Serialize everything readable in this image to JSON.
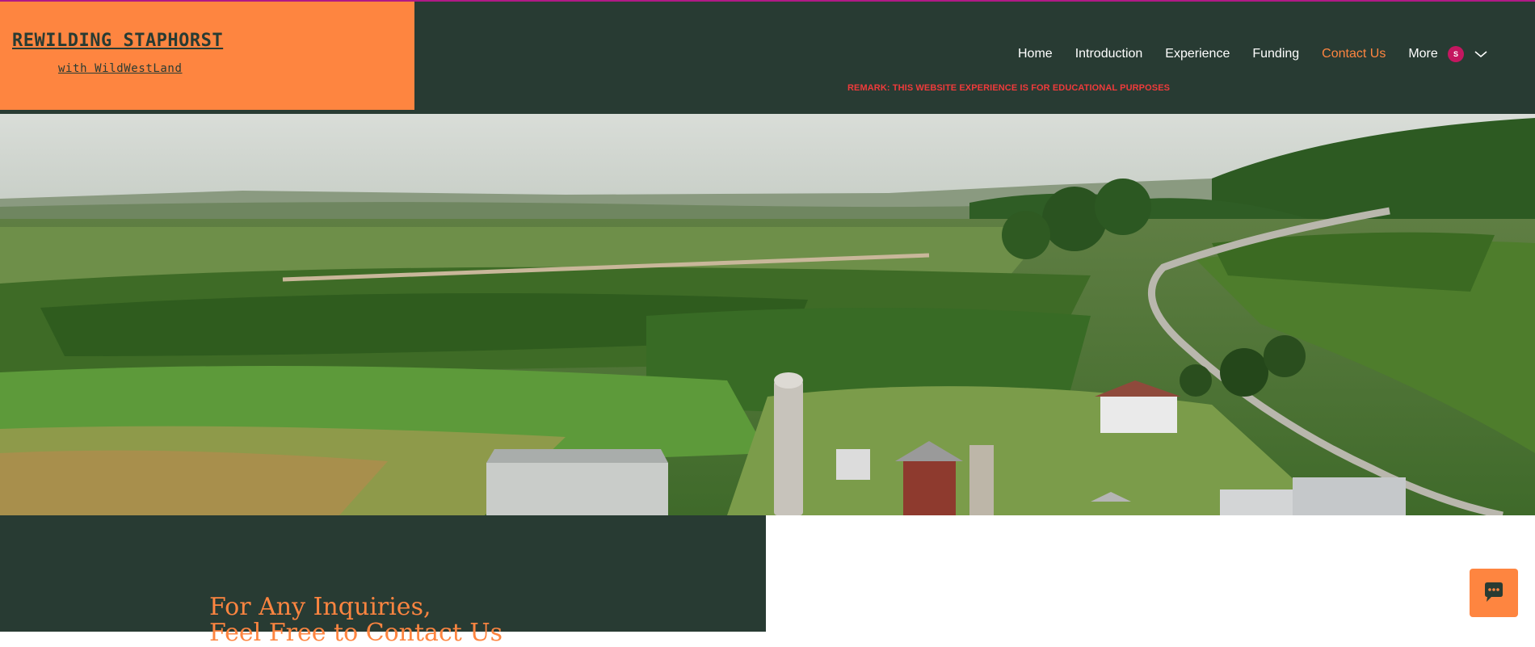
{
  "logo": {
    "title": "REWILDING STAPHORST",
    "subtitle": "with WildWestLand"
  },
  "nav": {
    "items": [
      {
        "label": "Home"
      },
      {
        "label": "Introduction"
      },
      {
        "label": "Experience"
      },
      {
        "label": "Funding"
      },
      {
        "label": "Contact Us",
        "active": true
      },
      {
        "label": "More"
      }
    ]
  },
  "account": {
    "avatar_initial": "S",
    "icon": "chevron-down-icon"
  },
  "remark": "REMARK: THIS WEBSITE EXPERIENCE IS FOR EDUCATIONAL PURPOSES",
  "hero": {
    "image": "aerial-farmland-photo"
  },
  "contact": {
    "heading_line1": "For Any Inquiries,",
    "heading_line2": "Feel Free to Contact Us"
  },
  "chat": {
    "icon": "chat-bubble-icon"
  },
  "colors": {
    "header_bg": "#283b33",
    "accent_orange": "#fe8540",
    "remark_red": "#ef3b3b",
    "avatar_pink": "#c41760",
    "top_line_magenta": "#b01a86"
  }
}
